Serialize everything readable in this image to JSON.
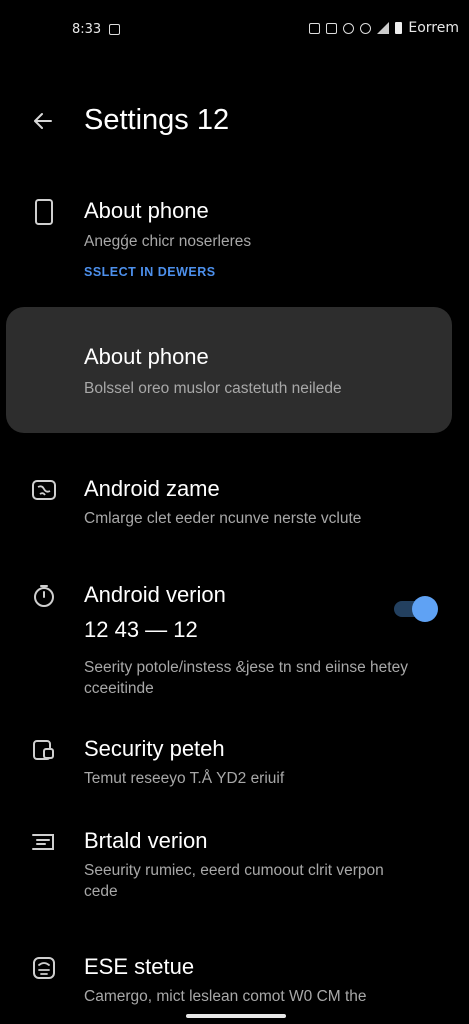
{
  "status_bar": {
    "time": "8:33",
    "carrier": "Eorrem"
  },
  "header": {
    "title": "Settings 12"
  },
  "items": [
    {
      "title": "About phone",
      "subtitle": "Anegǵe chicr noserleres",
      "link": "SSLECT  IN DEWERS",
      "icon": "phone-outline-icon"
    },
    {
      "title": "About phone",
      "subtitle": "Bolssel oreo muslor castetuth neilede",
      "icon": "none"
    },
    {
      "title": "Android zame",
      "subtitle": "Cmlarge clet eeder ncunve nerste vclute",
      "icon": "globe-icon"
    },
    {
      "title": "Android verion",
      "value": "12 43 — 12",
      "subtitle": "Seerity potole/instess &jese tn snd eiinse hetey cceeitinde",
      "icon": "timer-icon",
      "toggle_on": true
    },
    {
      "title": "Security peteh",
      "subtitle": "Temut reseeyo  T.Å YD2 eriuif",
      "icon": "security-icon"
    },
    {
      "title": "Brtald verion",
      "subtitle": "Seeurity rumiec, eeerd cumoout clrit verpon cede",
      "icon": "build-icon"
    },
    {
      "title": "ESE stetue",
      "subtitle": "Camergo, mict leslean comot W0 CM the",
      "icon": "status-icon"
    }
  ],
  "colors": {
    "background": "#000000",
    "highlight": "#2d2d2d",
    "accent": "#5fa2f4",
    "link": "#4d90ec",
    "secondary_text": "#a8a8a8"
  }
}
